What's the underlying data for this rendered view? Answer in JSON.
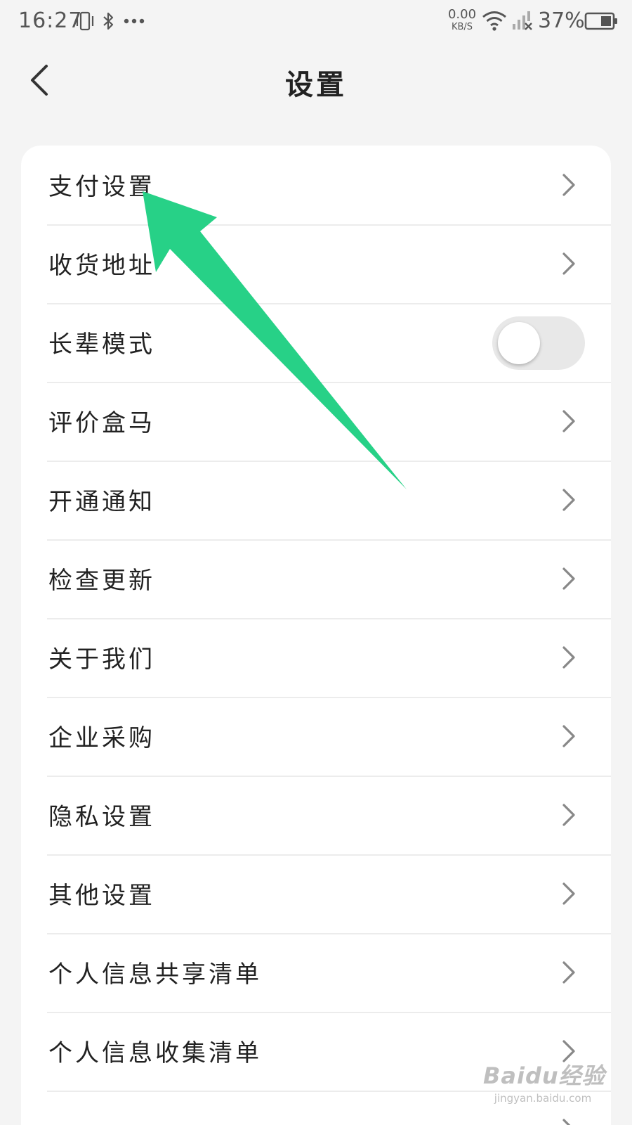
{
  "status_bar": {
    "time": "16:27",
    "net_speed_value": "0.00",
    "net_speed_unit": "KB/S",
    "battery_percent": "37%"
  },
  "nav": {
    "title": "设置"
  },
  "settings": {
    "items": [
      {
        "label": "支付设置",
        "control": "chevron"
      },
      {
        "label": "收货地址",
        "control": "chevron"
      },
      {
        "label": "长辈模式",
        "control": "toggle",
        "toggle_on": false
      },
      {
        "label": "评价盒马",
        "control": "chevron"
      },
      {
        "label": "开通通知",
        "control": "chevron"
      },
      {
        "label": "检查更新",
        "control": "chevron"
      },
      {
        "label": "关于我们",
        "control": "chevron"
      },
      {
        "label": "企业采购",
        "control": "chevron"
      },
      {
        "label": "隐私设置",
        "control": "chevron"
      },
      {
        "label": "其他设置",
        "control": "chevron"
      },
      {
        "label": "个人信息共享清单",
        "control": "chevron"
      },
      {
        "label": "个人信息收集清单",
        "control": "chevron"
      },
      {
        "label": "",
        "control": "chevron"
      }
    ]
  },
  "annotation": {
    "color": "#27d187"
  },
  "watermark": {
    "logo_text": "Baidu经验",
    "url": "jingyan.baidu.com"
  },
  "colors": {
    "background": "#f4f4f4",
    "card": "#ffffff",
    "text": "#222222",
    "chevron": "#888888",
    "toggle_off": "#e8e8e8"
  }
}
